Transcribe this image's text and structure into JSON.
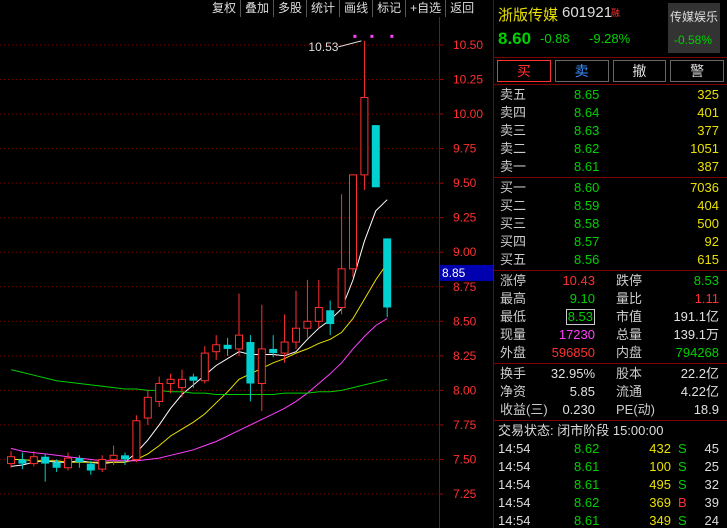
{
  "toolbar": [
    "复权",
    "叠加",
    "多股",
    "统计",
    "画线",
    "标记",
    "+自选",
    "返回"
  ],
  "chart": {
    "price_labels": [
      "10.50",
      "10.25",
      "10.00",
      "9.75",
      "9.50",
      "9.25",
      "9.00",
      "8.75",
      "8.50",
      "8.25",
      "8.00",
      "7.75",
      "7.50",
      "7.25"
    ],
    "current_price_tag": "8.85",
    "high_marker": "10.53",
    "colors": {
      "up": "#ff3030",
      "down": "#00d0d0",
      "ma5": "#ffffff",
      "ma10": "#e8e000",
      "ma20": "#ff40ff",
      "ma60": "#00d000"
    }
  },
  "chart_data": {
    "type": "candlestick",
    "ylim": [
      7.1,
      10.65
    ],
    "candles": [
      {
        "o": 7.47,
        "c": 7.52,
        "h": 7.56,
        "l": 7.44
      },
      {
        "o": 7.5,
        "c": 7.47,
        "h": 7.55,
        "l": 7.43
      },
      {
        "o": 7.47,
        "c": 7.52,
        "h": 7.56,
        "l": 7.45
      },
      {
        "o": 7.52,
        "c": 7.47,
        "h": 7.54,
        "l": 7.34
      },
      {
        "o": 7.48,
        "c": 7.44,
        "h": 7.5,
        "l": 7.41
      },
      {
        "o": 7.44,
        "c": 7.51,
        "h": 7.55,
        "l": 7.42
      },
      {
        "o": 7.51,
        "c": 7.48,
        "h": 7.53,
        "l": 7.44
      },
      {
        "o": 7.47,
        "c": 7.42,
        "h": 7.49,
        "l": 7.39
      },
      {
        "o": 7.43,
        "c": 7.5,
        "h": 7.53,
        "l": 7.41
      },
      {
        "o": 7.5,
        "c": 7.53,
        "h": 7.6,
        "l": 7.46
      },
      {
        "o": 7.53,
        "c": 7.5,
        "h": 7.55,
        "l": 7.46
      },
      {
        "o": 7.5,
        "c": 7.78,
        "h": 7.82,
        "l": 7.48
      },
      {
        "o": 7.8,
        "c": 7.95,
        "h": 8.0,
        "l": 7.75
      },
      {
        "o": 7.92,
        "c": 8.05,
        "h": 8.1,
        "l": 7.88
      },
      {
        "o": 8.05,
        "c": 8.08,
        "h": 8.12,
        "l": 7.98
      },
      {
        "o": 8.02,
        "c": 8.08,
        "h": 8.15,
        "l": 7.95
      },
      {
        "o": 8.1,
        "c": 8.07,
        "h": 8.12,
        "l": 8.02
      },
      {
        "o": 8.07,
        "c": 8.27,
        "h": 8.32,
        "l": 8.05
      },
      {
        "o": 8.28,
        "c": 8.33,
        "h": 8.4,
        "l": 8.22
      },
      {
        "o": 8.33,
        "c": 8.3,
        "h": 8.38,
        "l": 8.25
      },
      {
        "o": 8.3,
        "c": 8.4,
        "h": 8.7,
        "l": 8.25
      },
      {
        "o": 8.35,
        "c": 8.05,
        "h": 8.4,
        "l": 7.92
      },
      {
        "o": 8.05,
        "c": 8.3,
        "h": 8.62,
        "l": 7.85
      },
      {
        "o": 8.3,
        "c": 8.27,
        "h": 8.4,
        "l": 8.24
      },
      {
        "o": 8.27,
        "c": 8.35,
        "h": 8.55,
        "l": 8.2
      },
      {
        "o": 8.35,
        "c": 8.45,
        "h": 8.72,
        "l": 8.3
      },
      {
        "o": 8.45,
        "c": 8.5,
        "h": 8.8,
        "l": 8.38
      },
      {
        "o": 8.5,
        "c": 8.6,
        "h": 8.8,
        "l": 8.45
      },
      {
        "o": 8.58,
        "c": 8.48,
        "h": 8.65,
        "l": 8.4
      },
      {
        "o": 8.6,
        "c": 8.88,
        "h": 9.42,
        "l": 8.55
      },
      {
        "o": 8.88,
        "c": 9.56,
        "h": 9.56,
        "l": 8.82
      },
      {
        "o": 9.56,
        "c": 10.12,
        "h": 10.53,
        "l": 9.45
      },
      {
        "o": 9.92,
        "c": 9.47,
        "h": 9.92,
        "l": 9.47
      },
      {
        "o": 9.1,
        "c": 8.6,
        "h": 9.1,
        "l": 8.53
      }
    ],
    "series": [
      {
        "name": "MA5",
        "values": [
          7.45,
          7.46,
          7.48,
          7.49,
          7.48,
          7.48,
          7.49,
          7.48,
          7.47,
          7.48,
          7.48,
          7.55,
          7.64,
          7.75,
          7.87,
          7.97,
          8.04,
          8.11,
          8.18,
          8.23,
          8.28,
          8.26,
          8.26,
          8.26,
          8.25,
          8.28,
          8.37,
          8.45,
          8.51,
          8.59,
          8.8,
          9.08,
          9.3,
          9.38
        ]
      },
      {
        "name": "MA10",
        "values": [
          7.5,
          7.5,
          7.49,
          7.49,
          7.49,
          7.48,
          7.48,
          7.48,
          7.48,
          7.48,
          7.48,
          7.5,
          7.54,
          7.6,
          7.67,
          7.72,
          7.77,
          7.83,
          7.91,
          7.99,
          8.08,
          8.12,
          8.16,
          8.2,
          8.23,
          8.27,
          8.3,
          8.34,
          8.37,
          8.42,
          8.52,
          8.66,
          8.8,
          8.92
        ]
      },
      {
        "name": "MA20",
        "values": [
          7.58,
          7.56,
          7.55,
          7.54,
          7.53,
          7.52,
          7.51,
          7.5,
          7.49,
          7.49,
          7.49,
          7.49,
          7.5,
          7.51,
          7.53,
          7.55,
          7.57,
          7.6,
          7.63,
          7.67,
          7.71,
          7.75,
          7.79,
          7.83,
          7.87,
          7.92,
          7.98,
          8.05,
          8.12,
          8.2,
          8.3,
          8.39,
          8.47,
          8.52
        ]
      },
      {
        "name": "MA60",
        "values": [
          8.15,
          8.13,
          8.11,
          8.09,
          8.07,
          8.06,
          8.05,
          8.04,
          8.03,
          8.02,
          8.01,
          8.01,
          8.0,
          8.0,
          7.99,
          7.99,
          7.98,
          7.98,
          7.97,
          7.97,
          7.97,
          7.97,
          7.97,
          7.97,
          7.98,
          7.98,
          7.98,
          7.99,
          7.99,
          8.0,
          8.02,
          8.04,
          8.06,
          8.08
        ]
      }
    ]
  },
  "stock": {
    "name": "浙版传媒",
    "code": "601921",
    "code_tag": "融",
    "last": "8.60",
    "change": "-0.88",
    "change_pct": "-9.28%",
    "sector_name": "传媒娱乐",
    "sector_pct": "-0.58%"
  },
  "trade_buttons": {
    "buy": "买",
    "sell": "卖",
    "cancel": "撤",
    "alert": "警"
  },
  "asks": [
    {
      "label": "卖五",
      "price": "8.65",
      "vol": "325"
    },
    {
      "label": "卖四",
      "price": "8.64",
      "vol": "401"
    },
    {
      "label": "卖三",
      "price": "8.63",
      "vol": "377"
    },
    {
      "label": "卖二",
      "price": "8.62",
      "vol": "1051"
    },
    {
      "label": "卖一",
      "price": "8.61",
      "vol": "387"
    }
  ],
  "bids": [
    {
      "label": "买一",
      "price": "8.60",
      "vol": "7036"
    },
    {
      "label": "买二",
      "price": "8.59",
      "vol": "404"
    },
    {
      "label": "买三",
      "price": "8.58",
      "vol": "500"
    },
    {
      "label": "买四",
      "price": "8.57",
      "vol": "92"
    },
    {
      "label": "买五",
      "price": "8.56",
      "vol": "615"
    }
  ],
  "stats1": [
    {
      "l1": "涨停",
      "v1": "10.43",
      "c1": "red",
      "l2": "跌停",
      "v2": "8.53",
      "c2": "green"
    },
    {
      "l1": "最高",
      "v1": "9.10",
      "c1": "green",
      "l2": "量比",
      "v2": "1.11",
      "c2": "red"
    },
    {
      "l1": "最低",
      "v1": "8.53",
      "c1": "green",
      "l2": "市值",
      "v2": "191.1亿",
      "c2": "white"
    },
    {
      "l1": "现量",
      "v1": "17230",
      "c1": "magenta",
      "l2": "总量",
      "v2": "139.1万",
      "c2": "white"
    },
    {
      "l1": "外盘",
      "v1": "596850",
      "c1": "red",
      "l2": "内盘",
      "v2": "794268",
      "c2": "green"
    }
  ],
  "stats2": [
    {
      "l1": "换手",
      "v1": "32.95%",
      "l2": "股本",
      "v2": "22.2亿"
    },
    {
      "l1": "净资",
      "v1": "5.85",
      "l2": "流通",
      "v2": "4.22亿"
    },
    {
      "l1": "收益(三)",
      "v1": "0.230",
      "l2": "PE(动)",
      "v2": "18.9"
    }
  ],
  "trade_status": "交易状态: 闭市阶段 15:00:00",
  "ticks": [
    {
      "time": "14:54",
      "price": "8.62",
      "pc": "green",
      "vol": "432",
      "side": "S",
      "sc": "green",
      "num": "45"
    },
    {
      "time": "14:54",
      "price": "8.61",
      "pc": "green",
      "vol": "100",
      "side": "S",
      "sc": "green",
      "num": "25"
    },
    {
      "time": "14:54",
      "price": "8.61",
      "pc": "green",
      "vol": "495",
      "side": "S",
      "sc": "green",
      "num": "32"
    },
    {
      "time": "14:54",
      "price": "8.62",
      "pc": "green",
      "vol": "369",
      "side": "B",
      "sc": "red",
      "num": "39"
    },
    {
      "time": "14:54",
      "price": "8.61",
      "pc": "green",
      "vol": "349",
      "side": "S",
      "sc": "green",
      "num": "24"
    }
  ]
}
